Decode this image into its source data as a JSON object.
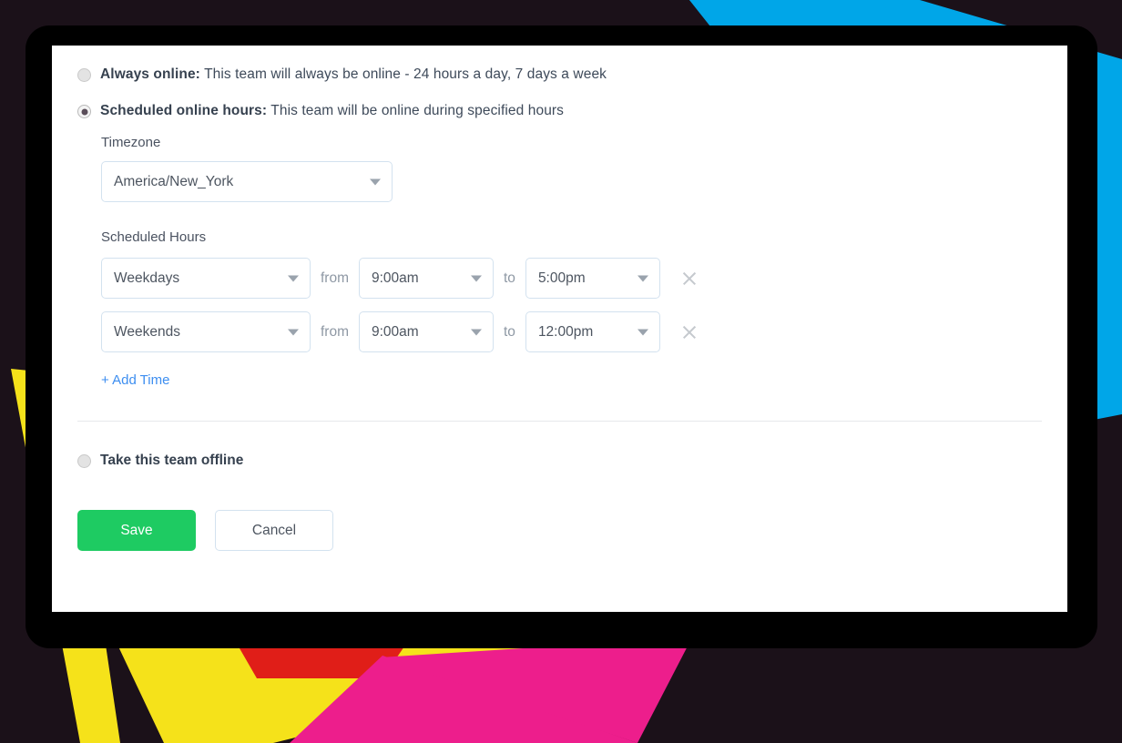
{
  "theme": {
    "page_background": "#1b1119",
    "device_frame": "#000000",
    "card_background": "#ffffff",
    "accent_blue": "#00a6e8",
    "accent_yellow": "#f5e21a",
    "accent_pink": "#ed1e8c",
    "accent_red": "#e01e18",
    "save_green": "#1ecb62",
    "link_blue": "#3d8ef0",
    "text_primary": "#36414f",
    "text_secondary": "#4d5560",
    "border_input": "#d3e2ef"
  },
  "options": {
    "always_online": {
      "label_strong": "Always online:",
      "label_rest": " This team will always be online - 24 hours a day, 7 days a week",
      "selected": false
    },
    "scheduled_online": {
      "label_strong": "Scheduled online hours:",
      "label_rest": " This team will be online during specified hours",
      "selected": true
    },
    "take_offline": {
      "label": "Take this team offline",
      "selected": false
    }
  },
  "timezone": {
    "label": "Timezone",
    "value": "America/New_York"
  },
  "scheduled_hours": {
    "label": "Scheduled Hours",
    "from_label": "from",
    "to_label": "to",
    "add_label": "+ Add Time",
    "rows": [
      {
        "day": "Weekdays",
        "from": "9:00am",
        "to": "5:00pm"
      },
      {
        "day": "Weekends",
        "from": "9:00am",
        "to": "12:00pm"
      }
    ]
  },
  "actions": {
    "save_label": "Save",
    "cancel_label": "Cancel"
  }
}
